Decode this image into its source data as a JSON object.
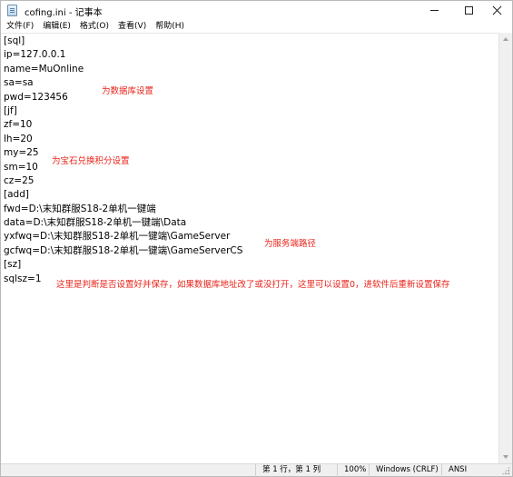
{
  "window": {
    "title": "cofing.ini - 记事本"
  },
  "menu": {
    "items": [
      {
        "label": "文件(F)"
      },
      {
        "label": "编辑(E)"
      },
      {
        "label": "格式(O)"
      },
      {
        "label": "查看(V)"
      },
      {
        "label": "帮助(H)"
      }
    ]
  },
  "editor": {
    "lines": [
      "[sql]",
      "ip=127.0.0.1",
      "name=MuOnline",
      "sa=sa",
      "pwd=123456",
      "[jf]",
      "zf=10",
      "lh=20",
      "my=25",
      "sm=10",
      "cz=25",
      "[add]",
      "fwd=D:\\末知群服S18-2单机一键端",
      "data=D:\\末知群服S18-2单机一键端\\Data",
      "yxfwq=D:\\末知群服S18-2单机一键端\\GameServer",
      "gcfwq=D:\\末知群服S18-2单机一键端\\GameServerCS",
      "[sz]",
      "sqlsz=1"
    ],
    "annotations": {
      "db": "为数据库设置",
      "jf": "为宝石兑换积分设置",
      "path": "为服务端路径",
      "sz": "这里是判断是否设置好并保存，如果数据库地址改了或没打开，这里可以设置0，进软件后重新设置保存"
    },
    "annotation_color": "#e8231a"
  },
  "status": {
    "position": "第 1 行，第 1 列",
    "zoom": "100%",
    "line_ending": "Windows (CRLF)",
    "encoding": "ANSI"
  }
}
